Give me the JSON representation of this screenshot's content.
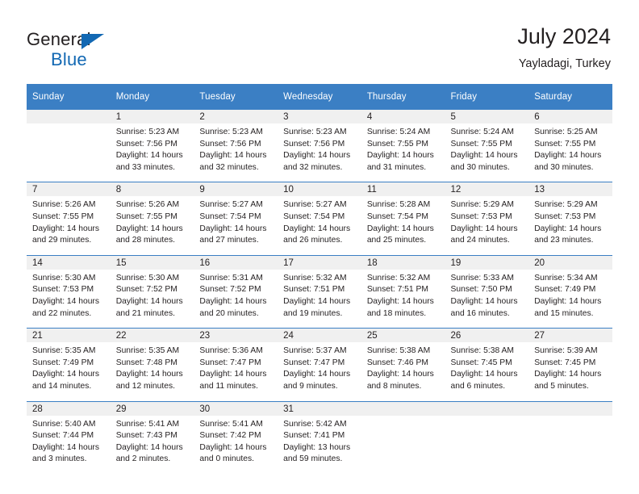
{
  "brand": {
    "name_part1": "General",
    "name_part2": "Blue",
    "accent_color": "#1268b3",
    "logo_icon": "triangle-flag-icon"
  },
  "header": {
    "title": "July 2024",
    "subtitle": "Yayladagi, Turkey"
  },
  "calendar": {
    "header_bg": "#3b7fc4",
    "daynum_bg": "#f0f0f0",
    "weekday_headers": [
      "Sunday",
      "Monday",
      "Tuesday",
      "Wednesday",
      "Thursday",
      "Friday",
      "Saturday"
    ],
    "weeks": [
      [
        {
          "day": "",
          "lines": []
        },
        {
          "day": "1",
          "lines": [
            "Sunrise: 5:23 AM",
            "Sunset: 7:56 PM",
            "Daylight: 14 hours",
            "and 33 minutes."
          ]
        },
        {
          "day": "2",
          "lines": [
            "Sunrise: 5:23 AM",
            "Sunset: 7:56 PM",
            "Daylight: 14 hours",
            "and 32 minutes."
          ]
        },
        {
          "day": "3",
          "lines": [
            "Sunrise: 5:23 AM",
            "Sunset: 7:56 PM",
            "Daylight: 14 hours",
            "and 32 minutes."
          ]
        },
        {
          "day": "4",
          "lines": [
            "Sunrise: 5:24 AM",
            "Sunset: 7:55 PM",
            "Daylight: 14 hours",
            "and 31 minutes."
          ]
        },
        {
          "day": "5",
          "lines": [
            "Sunrise: 5:24 AM",
            "Sunset: 7:55 PM",
            "Daylight: 14 hours",
            "and 30 minutes."
          ]
        },
        {
          "day": "6",
          "lines": [
            "Sunrise: 5:25 AM",
            "Sunset: 7:55 PM",
            "Daylight: 14 hours",
            "and 30 minutes."
          ]
        }
      ],
      [
        {
          "day": "7",
          "lines": [
            "Sunrise: 5:26 AM",
            "Sunset: 7:55 PM",
            "Daylight: 14 hours",
            "and 29 minutes."
          ]
        },
        {
          "day": "8",
          "lines": [
            "Sunrise: 5:26 AM",
            "Sunset: 7:55 PM",
            "Daylight: 14 hours",
            "and 28 minutes."
          ]
        },
        {
          "day": "9",
          "lines": [
            "Sunrise: 5:27 AM",
            "Sunset: 7:54 PM",
            "Daylight: 14 hours",
            "and 27 minutes."
          ]
        },
        {
          "day": "10",
          "lines": [
            "Sunrise: 5:27 AM",
            "Sunset: 7:54 PM",
            "Daylight: 14 hours",
            "and 26 minutes."
          ]
        },
        {
          "day": "11",
          "lines": [
            "Sunrise: 5:28 AM",
            "Sunset: 7:54 PM",
            "Daylight: 14 hours",
            "and 25 minutes."
          ]
        },
        {
          "day": "12",
          "lines": [
            "Sunrise: 5:29 AM",
            "Sunset: 7:53 PM",
            "Daylight: 14 hours",
            "and 24 minutes."
          ]
        },
        {
          "day": "13",
          "lines": [
            "Sunrise: 5:29 AM",
            "Sunset: 7:53 PM",
            "Daylight: 14 hours",
            "and 23 minutes."
          ]
        }
      ],
      [
        {
          "day": "14",
          "lines": [
            "Sunrise: 5:30 AM",
            "Sunset: 7:53 PM",
            "Daylight: 14 hours",
            "and 22 minutes."
          ]
        },
        {
          "day": "15",
          "lines": [
            "Sunrise: 5:30 AM",
            "Sunset: 7:52 PM",
            "Daylight: 14 hours",
            "and 21 minutes."
          ]
        },
        {
          "day": "16",
          "lines": [
            "Sunrise: 5:31 AM",
            "Sunset: 7:52 PM",
            "Daylight: 14 hours",
            "and 20 minutes."
          ]
        },
        {
          "day": "17",
          "lines": [
            "Sunrise: 5:32 AM",
            "Sunset: 7:51 PM",
            "Daylight: 14 hours",
            "and 19 minutes."
          ]
        },
        {
          "day": "18",
          "lines": [
            "Sunrise: 5:32 AM",
            "Sunset: 7:51 PM",
            "Daylight: 14 hours",
            "and 18 minutes."
          ]
        },
        {
          "day": "19",
          "lines": [
            "Sunrise: 5:33 AM",
            "Sunset: 7:50 PM",
            "Daylight: 14 hours",
            "and 16 minutes."
          ]
        },
        {
          "day": "20",
          "lines": [
            "Sunrise: 5:34 AM",
            "Sunset: 7:49 PM",
            "Daylight: 14 hours",
            "and 15 minutes."
          ]
        }
      ],
      [
        {
          "day": "21",
          "lines": [
            "Sunrise: 5:35 AM",
            "Sunset: 7:49 PM",
            "Daylight: 14 hours",
            "and 14 minutes."
          ]
        },
        {
          "day": "22",
          "lines": [
            "Sunrise: 5:35 AM",
            "Sunset: 7:48 PM",
            "Daylight: 14 hours",
            "and 12 minutes."
          ]
        },
        {
          "day": "23",
          "lines": [
            "Sunrise: 5:36 AM",
            "Sunset: 7:47 PM",
            "Daylight: 14 hours",
            "and 11 minutes."
          ]
        },
        {
          "day": "24",
          "lines": [
            "Sunrise: 5:37 AM",
            "Sunset: 7:47 PM",
            "Daylight: 14 hours",
            "and 9 minutes."
          ]
        },
        {
          "day": "25",
          "lines": [
            "Sunrise: 5:38 AM",
            "Sunset: 7:46 PM",
            "Daylight: 14 hours",
            "and 8 minutes."
          ]
        },
        {
          "day": "26",
          "lines": [
            "Sunrise: 5:38 AM",
            "Sunset: 7:45 PM",
            "Daylight: 14 hours",
            "and 6 minutes."
          ]
        },
        {
          "day": "27",
          "lines": [
            "Sunrise: 5:39 AM",
            "Sunset: 7:45 PM",
            "Daylight: 14 hours",
            "and 5 minutes."
          ]
        }
      ],
      [
        {
          "day": "28",
          "lines": [
            "Sunrise: 5:40 AM",
            "Sunset: 7:44 PM",
            "Daylight: 14 hours",
            "and 3 minutes."
          ]
        },
        {
          "day": "29",
          "lines": [
            "Sunrise: 5:41 AM",
            "Sunset: 7:43 PM",
            "Daylight: 14 hours",
            "and 2 minutes."
          ]
        },
        {
          "day": "30",
          "lines": [
            "Sunrise: 5:41 AM",
            "Sunset: 7:42 PM",
            "Daylight: 14 hours",
            "and 0 minutes."
          ]
        },
        {
          "day": "31",
          "lines": [
            "Sunrise: 5:42 AM",
            "Sunset: 7:41 PM",
            "Daylight: 13 hours",
            "and 59 minutes."
          ]
        },
        {
          "day": "",
          "lines": []
        },
        {
          "day": "",
          "lines": []
        },
        {
          "day": "",
          "lines": []
        }
      ]
    ]
  }
}
